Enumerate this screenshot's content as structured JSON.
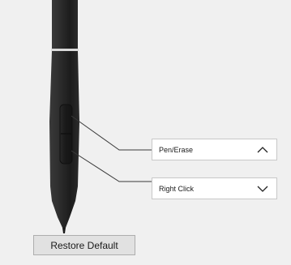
{
  "upper_button": {
    "selected": "Pen/Erase",
    "chevron_icon": "chevron-up-icon"
  },
  "lower_button": {
    "selected": "Right Click",
    "chevron_icon": "chevron-down-icon"
  },
  "restore_label": "Restore Default",
  "colors": {
    "pen_body": "#2b2b2b",
    "leader_line": "#3a3a3a",
    "background": "#f0f0f0"
  }
}
